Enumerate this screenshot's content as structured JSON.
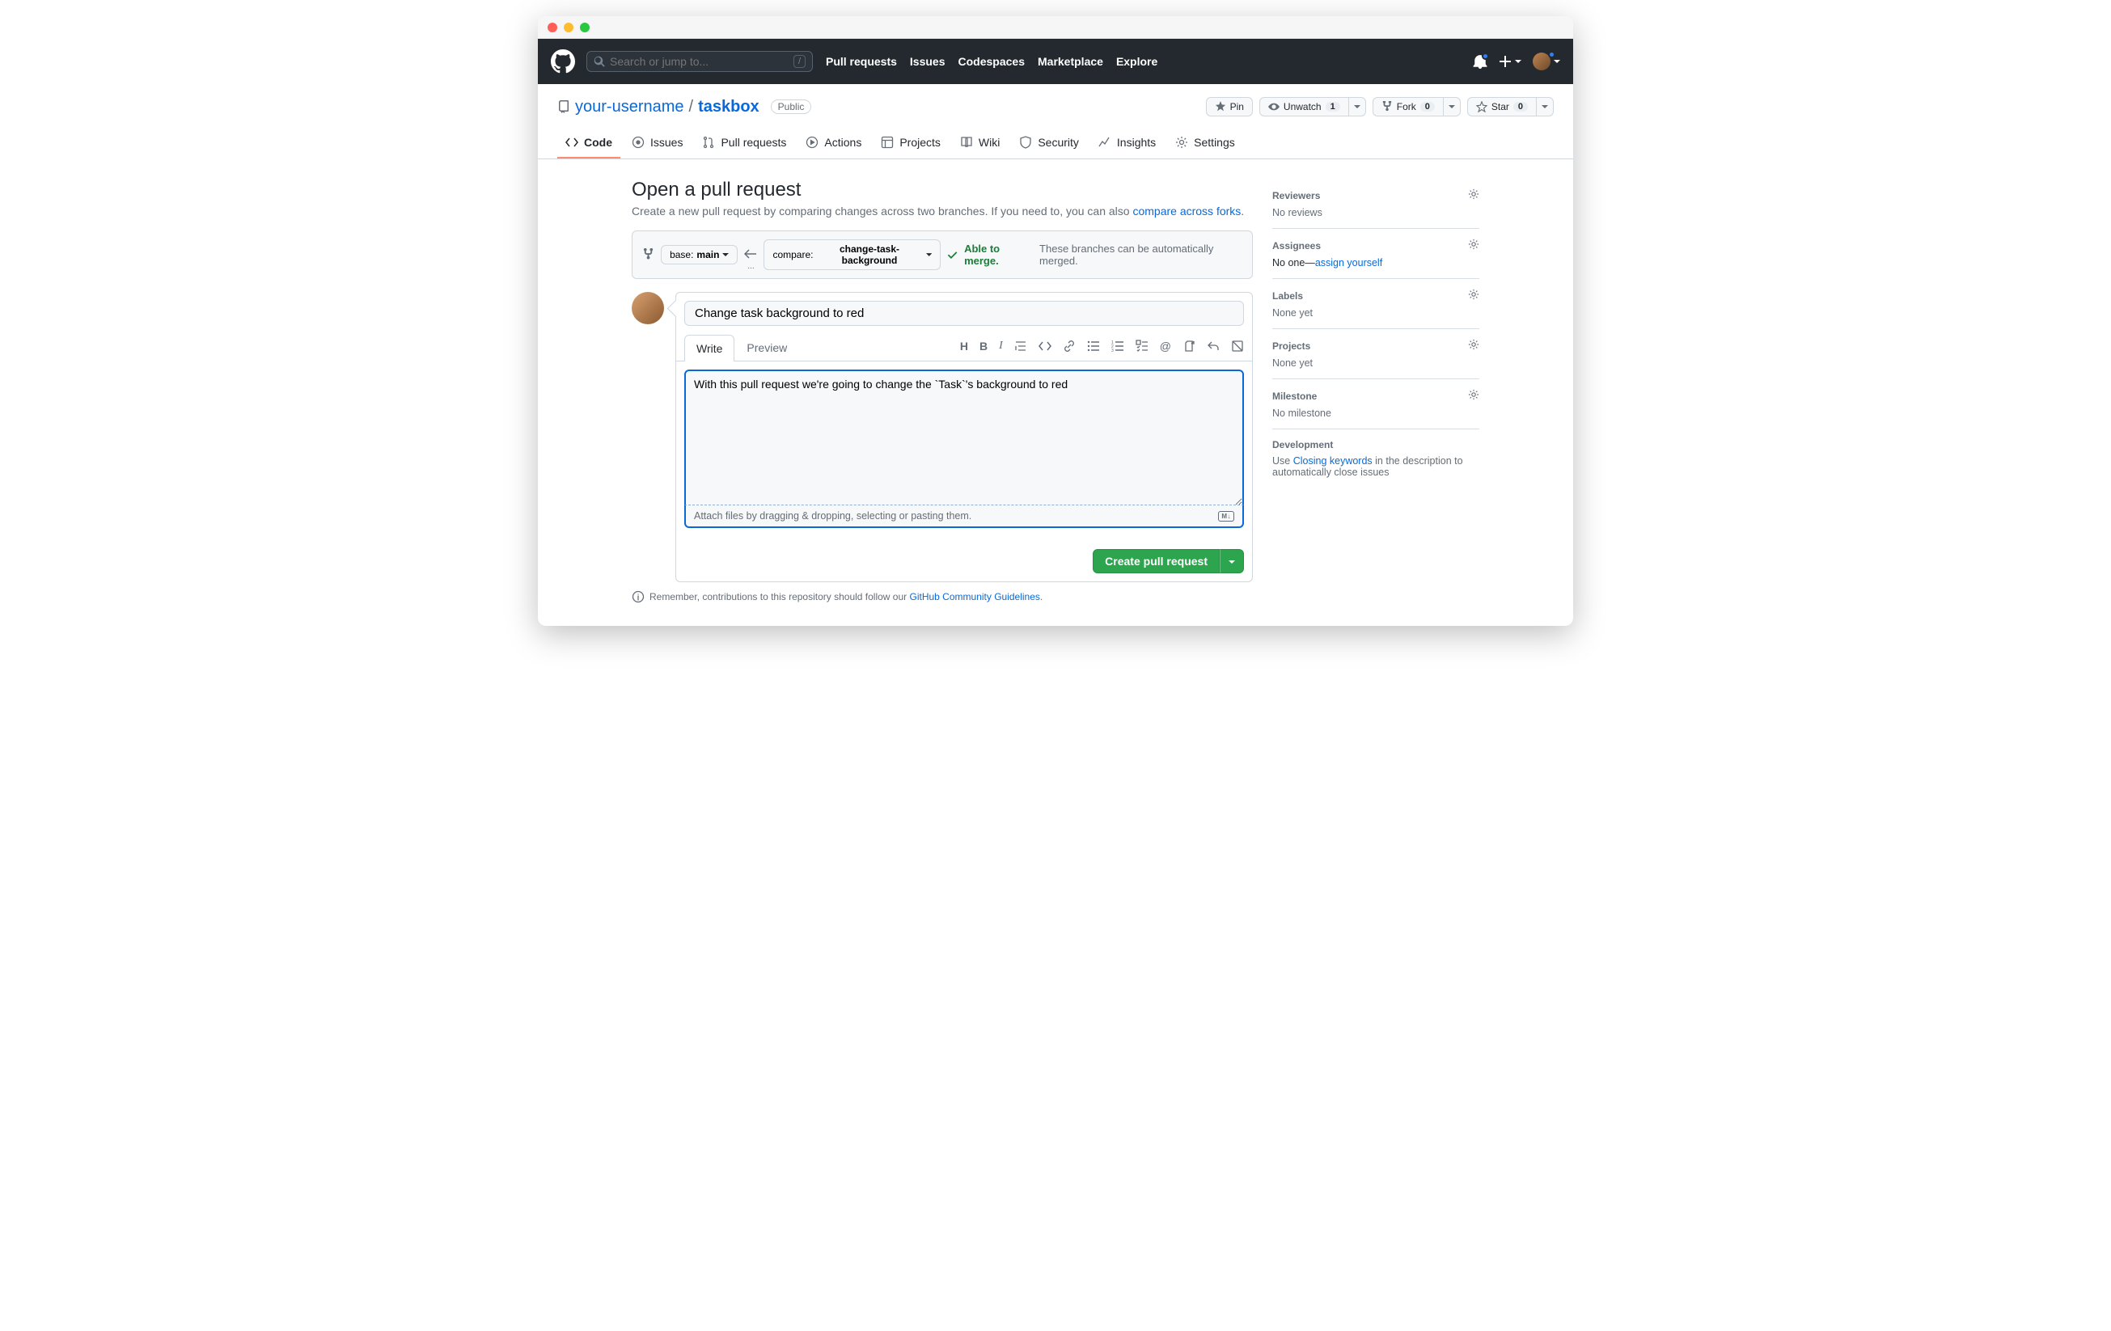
{
  "search": {
    "placeholder": "Search or jump to..."
  },
  "topnav": {
    "pull_requests": "Pull requests",
    "issues": "Issues",
    "codespaces": "Codespaces",
    "marketplace": "Marketplace",
    "explore": "Explore"
  },
  "repo": {
    "owner": "your-username",
    "name": "taskbox",
    "visibility": "Public"
  },
  "repo_actions": {
    "pin": "Pin",
    "unwatch": "Unwatch",
    "unwatch_count": "1",
    "fork": "Fork",
    "fork_count": "0",
    "star": "Star",
    "star_count": "0"
  },
  "repo_tabs": {
    "code": "Code",
    "issues": "Issues",
    "pull_requests": "Pull requests",
    "actions": "Actions",
    "projects": "Projects",
    "wiki": "Wiki",
    "security": "Security",
    "insights": "Insights",
    "settings": "Settings"
  },
  "page": {
    "title": "Open a pull request",
    "subtitle_prefix": "Create a new pull request by comparing changes across two branches. If you need to, you can also ",
    "subtitle_link": "compare across forks",
    "subtitle_suffix": "."
  },
  "compare": {
    "base_label": "base: ",
    "base_value": "main",
    "compare_label": "compare: ",
    "compare_value": "change-task-background",
    "merge_ok": "Able to merge.",
    "merge_msg": "These branches can be automatically merged."
  },
  "form": {
    "title_value": "Change task background to red",
    "write_tab": "Write",
    "preview_tab": "Preview",
    "body_value": "With this pull request we're going to change the `Task`'s background to red",
    "attach_hint": "Attach files by dragging & dropping, selecting or pasting them.",
    "submit": "Create pull request"
  },
  "remember": {
    "prefix": "Remember, contributions to this repository should follow our ",
    "link": "GitHub Community Guidelines",
    "suffix": "."
  },
  "sidebar": {
    "reviewers": {
      "title": "Reviewers",
      "body": "No reviews"
    },
    "assignees": {
      "title": "Assignees",
      "no_one": "No one—",
      "assign_self": "assign yourself"
    },
    "labels": {
      "title": "Labels",
      "body": "None yet"
    },
    "projects": {
      "title": "Projects",
      "body": "None yet"
    },
    "milestone": {
      "title": "Milestone",
      "body": "No milestone"
    },
    "development": {
      "title": "Development",
      "prefix": "Use ",
      "link": "Closing keywords",
      "suffix": " in the description to automatically close issues"
    }
  }
}
